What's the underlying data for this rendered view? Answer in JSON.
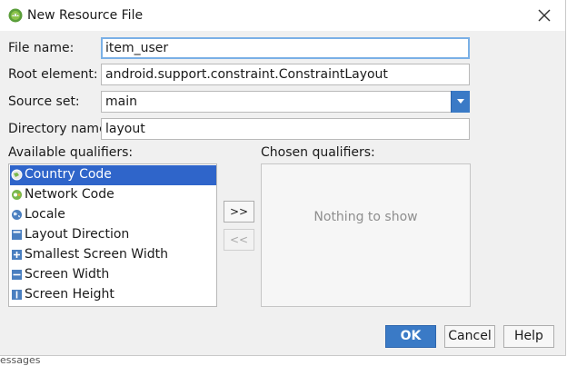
{
  "window": {
    "title": "New Resource File"
  },
  "form": {
    "file_name_label": "File name:",
    "file_name_value": "item_user",
    "root_element_label": "Root element:",
    "root_element_value": "android.support.constraint.ConstraintLayout",
    "source_set_label": "Source set:",
    "source_set_value": "main",
    "directory_name_label": "Directory name:",
    "directory_name_value": "layout"
  },
  "qualifiers": {
    "available_label": "Available qualifiers:",
    "chosen_label": "Chosen qualifiers:",
    "chosen_empty_text": "Nothing to show",
    "add_button": ">>",
    "remove_button": "<<",
    "available_items": [
      {
        "label": "Country Code",
        "icon": "country-code-icon",
        "selected": true
      },
      {
        "label": "Network Code",
        "icon": "network-code-icon",
        "selected": false
      },
      {
        "label": "Locale",
        "icon": "globe-icon",
        "selected": false
      },
      {
        "label": "Layout Direction",
        "icon": "layout-direction-icon",
        "selected": false
      },
      {
        "label": "Smallest Screen Width",
        "icon": "smallest-screen-width-icon",
        "selected": false
      },
      {
        "label": "Screen Width",
        "icon": "screen-width-icon",
        "selected": false
      },
      {
        "label": "Screen Height",
        "icon": "screen-height-icon",
        "selected": false
      }
    ]
  },
  "buttons": {
    "ok": "OK",
    "cancel": "Cancel",
    "help": "Help"
  },
  "background": {
    "partial_text": "essages"
  },
  "colors": {
    "accent": "#3a7ac6",
    "selection": "#2f65ca"
  }
}
